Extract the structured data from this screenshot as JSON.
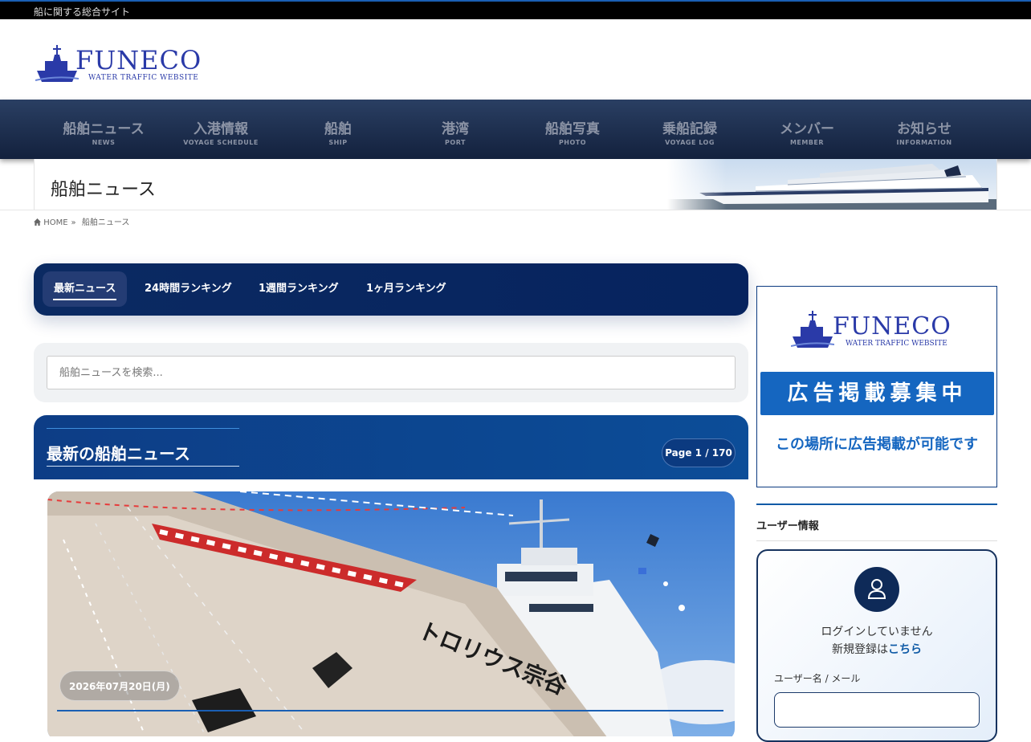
{
  "topbar": {
    "tagline": "船に関する総合サイト"
  },
  "logo": {
    "name": "FUNECO",
    "tagline": "WATER TRAFFIC WEBSITE"
  },
  "nav": [
    {
      "ja": "船舶ニュース",
      "en": "NEWS"
    },
    {
      "ja": "入港情報",
      "en": "VOYAGE SCHEDULE"
    },
    {
      "ja": "船舶",
      "en": "SHIP"
    },
    {
      "ja": "港湾",
      "en": "PORT"
    },
    {
      "ja": "船舶写真",
      "en": "PHOTO"
    },
    {
      "ja": "乗船記録",
      "en": "VOYAGE LOG"
    },
    {
      "ja": "メンバー",
      "en": "MEMBER"
    },
    {
      "ja": "お知らせ",
      "en": "INFORMATION"
    }
  ],
  "page": {
    "title": "船舶ニュース"
  },
  "breadcrumb": {
    "home": "HOME",
    "separator": "»",
    "current": "船舶ニュース"
  },
  "tabs": [
    {
      "label": "最新ニュース",
      "active": true
    },
    {
      "label": "24時間ランキング",
      "active": false
    },
    {
      "label": "1週間ランキング",
      "active": false
    },
    {
      "label": "1ヶ月ランキング",
      "active": false
    }
  ],
  "search": {
    "placeholder": "船舶ニュースを検索..."
  },
  "news": {
    "heading": "最新の船舶ニュース",
    "page_indicator": "Page 1 / 170",
    "featured": {
      "date": "2026年07月20日(月)",
      "ship_text": "トロリウス宗谷"
    }
  },
  "sidebar": {
    "ad": {
      "logo_name": "FUNECO",
      "logo_tagline": "WATER TRAFFIC WEBSITE",
      "banner": "広告掲載募集中",
      "text": "この場所に広告掲載が可能です"
    },
    "user": {
      "title": "ユーザー情報",
      "status": "ログインしていません",
      "register_prefix": "新規登録は",
      "register_link": "こちら",
      "username_label": "ユーザー名 / メール"
    }
  },
  "colors": {
    "brand": "#2a3aa8",
    "nav": "#13213d",
    "accent": "#1566c0",
    "panel": "#0b2a62"
  },
  "icons": {
    "home": "home-icon",
    "user": "user-icon",
    "logo_ship": "ship-logo-icon"
  }
}
